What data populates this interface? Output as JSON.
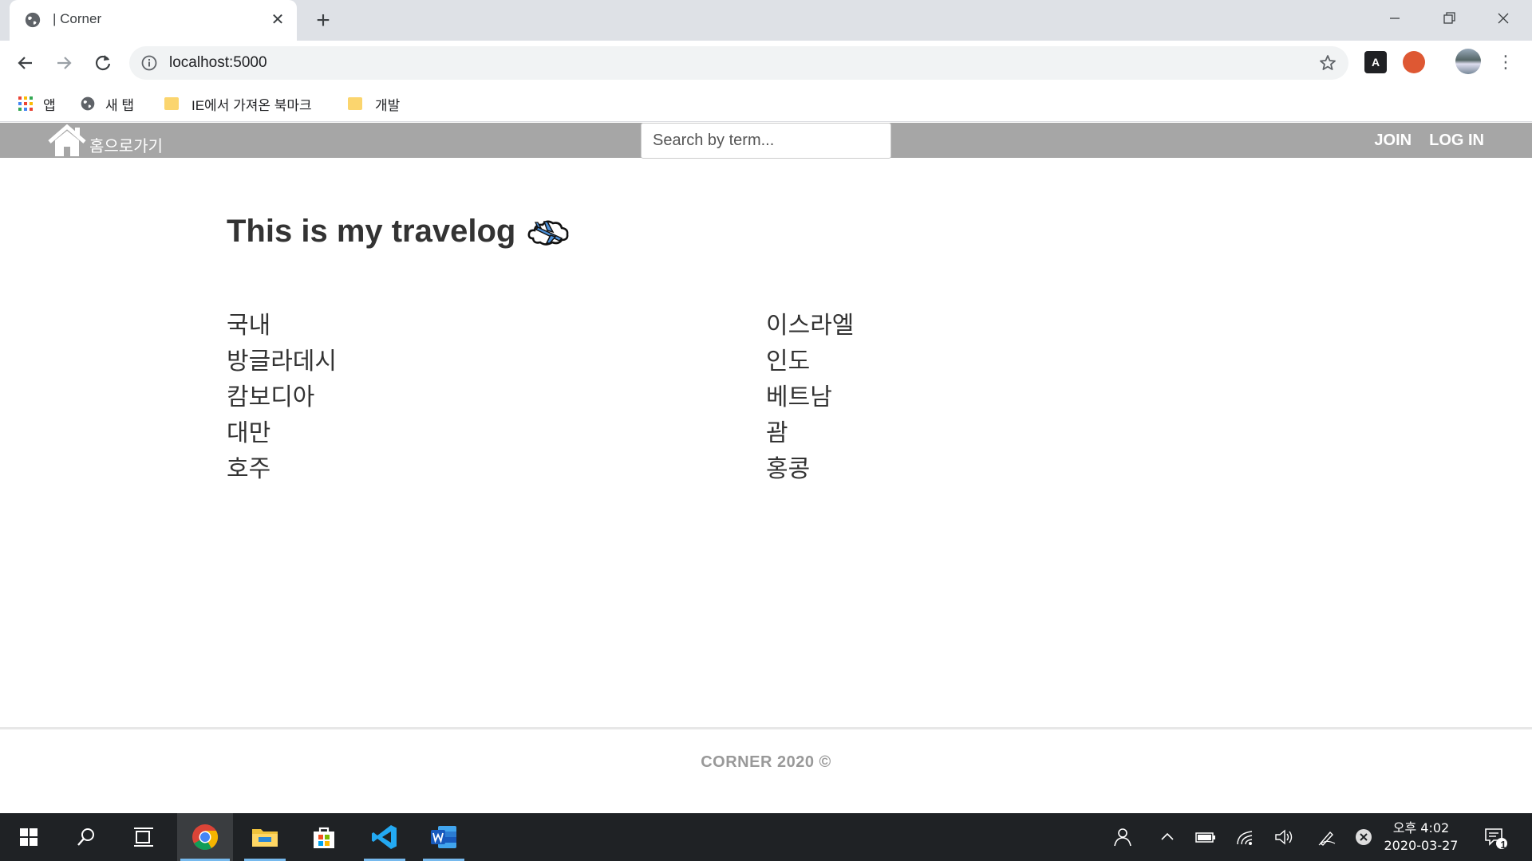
{
  "browser": {
    "tab_title": "| Corner",
    "url": "localhost:5000",
    "bookmarks": [
      "앱",
      "새 탭",
      "IE에서 가져온 북마크",
      "개발"
    ],
    "extension_a_label": "A"
  },
  "site": {
    "home_label": "홈으로가기",
    "search_placeholder": "Search by term...",
    "nav": {
      "join": "JOIN",
      "login": "LOG IN"
    },
    "title": "This is my travelog",
    "destinations_left": [
      "국내",
      "방글라데시",
      "캄보디아",
      "대만",
      "호주"
    ],
    "destinations_right": [
      "이스라엘",
      "인도",
      "베트남",
      "괌",
      "홍콩"
    ],
    "footer": "CORNER 2020 ©"
  },
  "taskbar": {
    "clock_time": "오후 4:02",
    "clock_date": "2020-03-27",
    "notification_count": "1",
    "apps": [
      "start-icon",
      "search-icon",
      "task-view-icon",
      "chrome-icon",
      "file-explorer-icon",
      "store-icon",
      "vscode-icon",
      "word-icon"
    ]
  },
  "colors": {
    "nav_bg": "#a6a6a6",
    "text": "#333333",
    "footer_text": "#999999",
    "taskbar": "#1f2225"
  }
}
